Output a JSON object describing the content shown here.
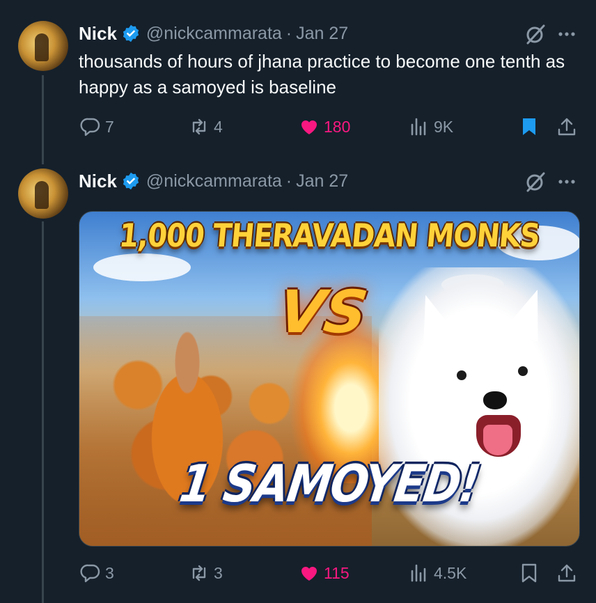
{
  "tweets": [
    {
      "author_name": "Nick",
      "handle": "@nickcammarata",
      "separator": "·",
      "date": "Jan 27",
      "text": "thousands of hours of jhana practice to become one tenth as happy as a samoyed is baseline",
      "replies": "7",
      "retweets": "4",
      "likes": "180",
      "views": "9K",
      "bookmarked": true
    },
    {
      "author_name": "Nick",
      "handle": "@nickcammarata",
      "separator": "·",
      "date": "Jan 27",
      "image": {
        "top_text": "1,000 THERAVADAN MONKS",
        "middle_text": "VS",
        "bottom_text": "1 SAMOYED!"
      },
      "replies": "3",
      "retweets": "3",
      "likes": "115",
      "views": "4.5K",
      "bookmarked": false
    }
  ],
  "icons": {
    "verified": "verified-badge-icon",
    "grok": "grok-icon",
    "more": "more-icon",
    "reply": "reply-icon",
    "retweet": "retweet-icon",
    "like": "heart-icon",
    "views": "views-icon",
    "bookmark": "bookmark-icon",
    "share": "share-icon"
  },
  "colors": {
    "background": "#15202b",
    "text": "#f7f9f9",
    "secondary": "#8b98a5",
    "like": "#f91880",
    "accent": "#1d9bf0"
  }
}
